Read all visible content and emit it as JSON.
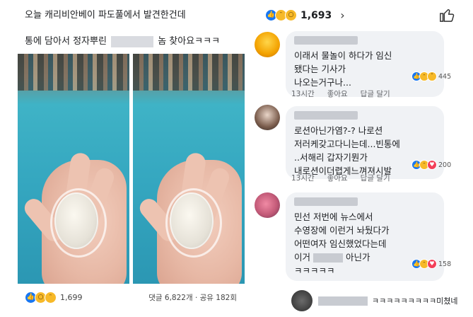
{
  "post": {
    "line1": "오늘 캐리비안베이 파도풀에서 발견한건데",
    "line2_prefix": "통에 담아서 정자뿌린",
    "line2_suffix": "놈 찾아요ㅋㅋㅋ",
    "reaction_count": "1,699",
    "meta": "댓글 6,822개 · 공유 182회"
  },
  "comments_header": {
    "reaction_count": "1,693",
    "chevron": "›"
  },
  "comments": [
    {
      "lines": [
        "이래서 물놀이 하다가 임신",
        "됐다는 기사가",
        "나오는거구나..."
      ],
      "reaction_count": "445",
      "time": "13시간",
      "like": "좋아요",
      "reply": "답글 달기"
    },
    {
      "lines": [
        "로션아닌가염?-? 나로션",
        "저러케갖고다니는데...빈통에",
        "..서해리 갑자기뭔가",
        "내로션이더렵게느껴져시발"
      ],
      "reaction_count": "200",
      "time": "13시간",
      "like": "좋아요",
      "reply": "답글 달기"
    },
    {
      "lines": [
        "민선 저번에 뉴스에서",
        "수영장에 이런거 놔뒀다가",
        "어떤여자 임신했었다는데"
      ],
      "line4_prefix": "이거",
      "line4_suffix": "아닌가",
      "line5": "ㅋㅋㅋㅋㅋ",
      "reaction_count": "158"
    }
  ],
  "last_comment": {
    "text": "ㅋㅋㅋㅋㅋㅋㅋㅋㅋ미쳤네"
  },
  "colors": {
    "like_blue": "#1877f2",
    "haha_yellow": "#f7b928",
    "love_red": "#f33e58",
    "bubble_bg": "#f0f2f5"
  },
  "icons": [
    "like-icon",
    "haha-icon",
    "wow-icon",
    "sad-icon",
    "thumbs-up-icon",
    "chevron-right-icon"
  ]
}
